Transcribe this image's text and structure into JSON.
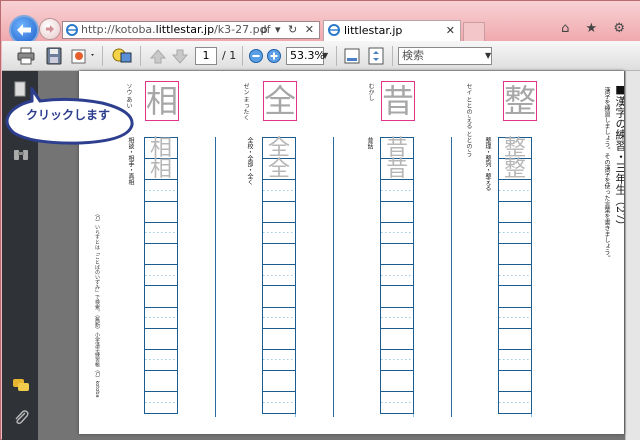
{
  "browser": {
    "address": {
      "url_prefix": "http://kotoba.",
      "url_domain": "littlestar.jp",
      "url_path": "/k3-27.pdf",
      "controls": "ρ ▾ ↻ ✕"
    },
    "tab": {
      "label": "littlestar.jp",
      "close": "✕"
    },
    "window_icons": "⌂ ★ ⚙"
  },
  "pdf_toolbar": {
    "page_current": "1",
    "page_total": "/ 1",
    "zoom": "53.3%",
    "search_placeholder": "検索"
  },
  "callout": {
    "text": "クリックします"
  },
  "worksheet": {
    "title": "■漢字の練習・三年生（27）",
    "instructions": "漢字を練習しましょう。その漢字を使った言葉を書きましょう。",
    "copyright": "（C）いらすとは「ことばのいずみ」で検索。（無断）小学漢字練習帳（C）kotoba",
    "columns": [
      {
        "kanji": "整",
        "reading": "セイ ととの-える ととの-う",
        "words": "整理・整列・整える",
        "trace": [
          "整",
          "整"
        ]
      },
      {
        "kanji": "昔",
        "reading": "むかし",
        "words": "昔話",
        "trace": [
          "昔",
          "昔"
        ]
      },
      {
        "kanji": "全",
        "reading": "ゼン まったく",
        "words": "全校・全部・全く",
        "trace": [
          "全",
          "全"
        ]
      },
      {
        "kanji": "相",
        "reading": "ソウ あい",
        "words": "相談・相手・真相",
        "trace": [
          "相",
          "相"
        ]
      }
    ]
  },
  "colors": {
    "accent_blue": "#1b5d91",
    "kanji_box": "#e0348a",
    "callout_text": "#2d3e8e"
  }
}
